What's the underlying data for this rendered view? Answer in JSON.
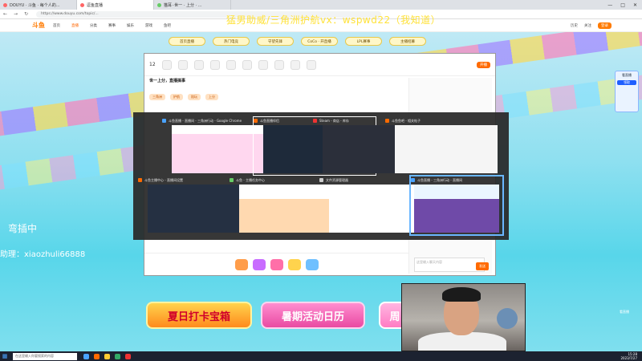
{
  "browser": {
    "tabs": [
      {
        "label": "DOUYU · 斗鱼 · 每个人的..."
      },
      {
        "label": "逗鱼直播",
        "active": true
      },
      {
        "label": "猫耳··世一 · 上分 · ..."
      }
    ],
    "url": "https://www.douyu.com/topic/..."
  },
  "site_header": {
    "logo": "斗鱼",
    "nav": [
      "首页",
      "直播",
      "分类",
      "赛事",
      "娱乐",
      "游戏",
      "鱼吧"
    ],
    "right": [
      "历史",
      "关注",
      "登录"
    ]
  },
  "overlay_text": "猛男助威/三角洲护航vx：wspwd22（我知道）",
  "left_status": "弯插中",
  "left_help": "助理：xiaozhuli66888",
  "pills": [
    "首页直播",
    "热门电竞",
    "守望先锋",
    "CoCo · 开直播",
    "LPL赛事",
    "主播招募"
  ],
  "inner_window": {
    "count": "12",
    "title": "世一上分，直播搞事",
    "tags": [
      "三角洲",
      "护航",
      "陪玩",
      "上分"
    ],
    "chat_placeholder": "这里输入聊天内容",
    "send_label": "发送",
    "live_button": "开播"
  },
  "switcher": {
    "thumbs": [
      {
        "label": "斗鱼直播 - 直播间 - 三角洲行动 - Google Chrome"
      },
      {
        "label": "斗鱼直播伴侣"
      },
      {
        "label": "Steam - 商店 - 库存"
      },
      {
        "label": "斗鱼鱼吧 - 相关帖子"
      },
      {
        "label": "斗鱼主播中心 - 直播间设置"
      },
      {
        "label": "斗鱼 - 主播任务中心"
      },
      {
        "label": "文件资源管理器"
      },
      {
        "label": "斗鱼直播 - 三角洲行动 - 直播间"
      }
    ]
  },
  "banners": {
    "b1": "夏日打卡宝箱",
    "b2": "暑期活动日历",
    "b3": "周"
  },
  "right_panel": {
    "title": "看直播",
    "btn": "领取",
    "tail": "看直播"
  },
  "taskbar": {
    "search": "在这里输入你要搜索的内容",
    "time": "15:28",
    "date": "2023/7/27"
  }
}
